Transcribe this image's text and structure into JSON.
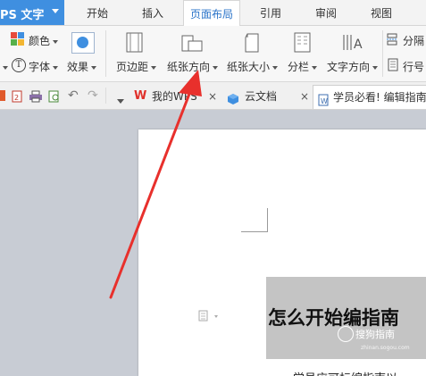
{
  "app": {
    "name": "PS 文字"
  },
  "menu": {
    "tabs": [
      {
        "label": "开始"
      },
      {
        "label": "插入"
      },
      {
        "label": "页面布局",
        "active": true
      },
      {
        "label": "引用"
      },
      {
        "label": "审阅"
      },
      {
        "label": "视图"
      }
    ]
  },
  "ribbon": {
    "color_label": "颜色",
    "font_label": "字体",
    "effect_label": "效果",
    "margins_label": "页边距",
    "orientation_label": "纸张方向",
    "size_label": "纸张大小",
    "columns_label": "分栏",
    "text_direction_label": "文字方向",
    "separator_label": "分隔",
    "line_number_label": "行号"
  },
  "doc_tabs": [
    {
      "label": "我的WPS"
    },
    {
      "label": "云文档"
    },
    {
      "label": "学员必看! 编辑指南",
      "active": true
    }
  ],
  "document": {
    "heading": "怎么开始编指南",
    "watermark": "搜狗指南",
    "watermark_sub": "zhinan.sogou.com",
    "body_partial": "学员应可标编指南以"
  },
  "colors": {
    "accent": "#2b74c9",
    "app_button": "#3f8fe0",
    "annotation_arrow": "#e8302c"
  }
}
